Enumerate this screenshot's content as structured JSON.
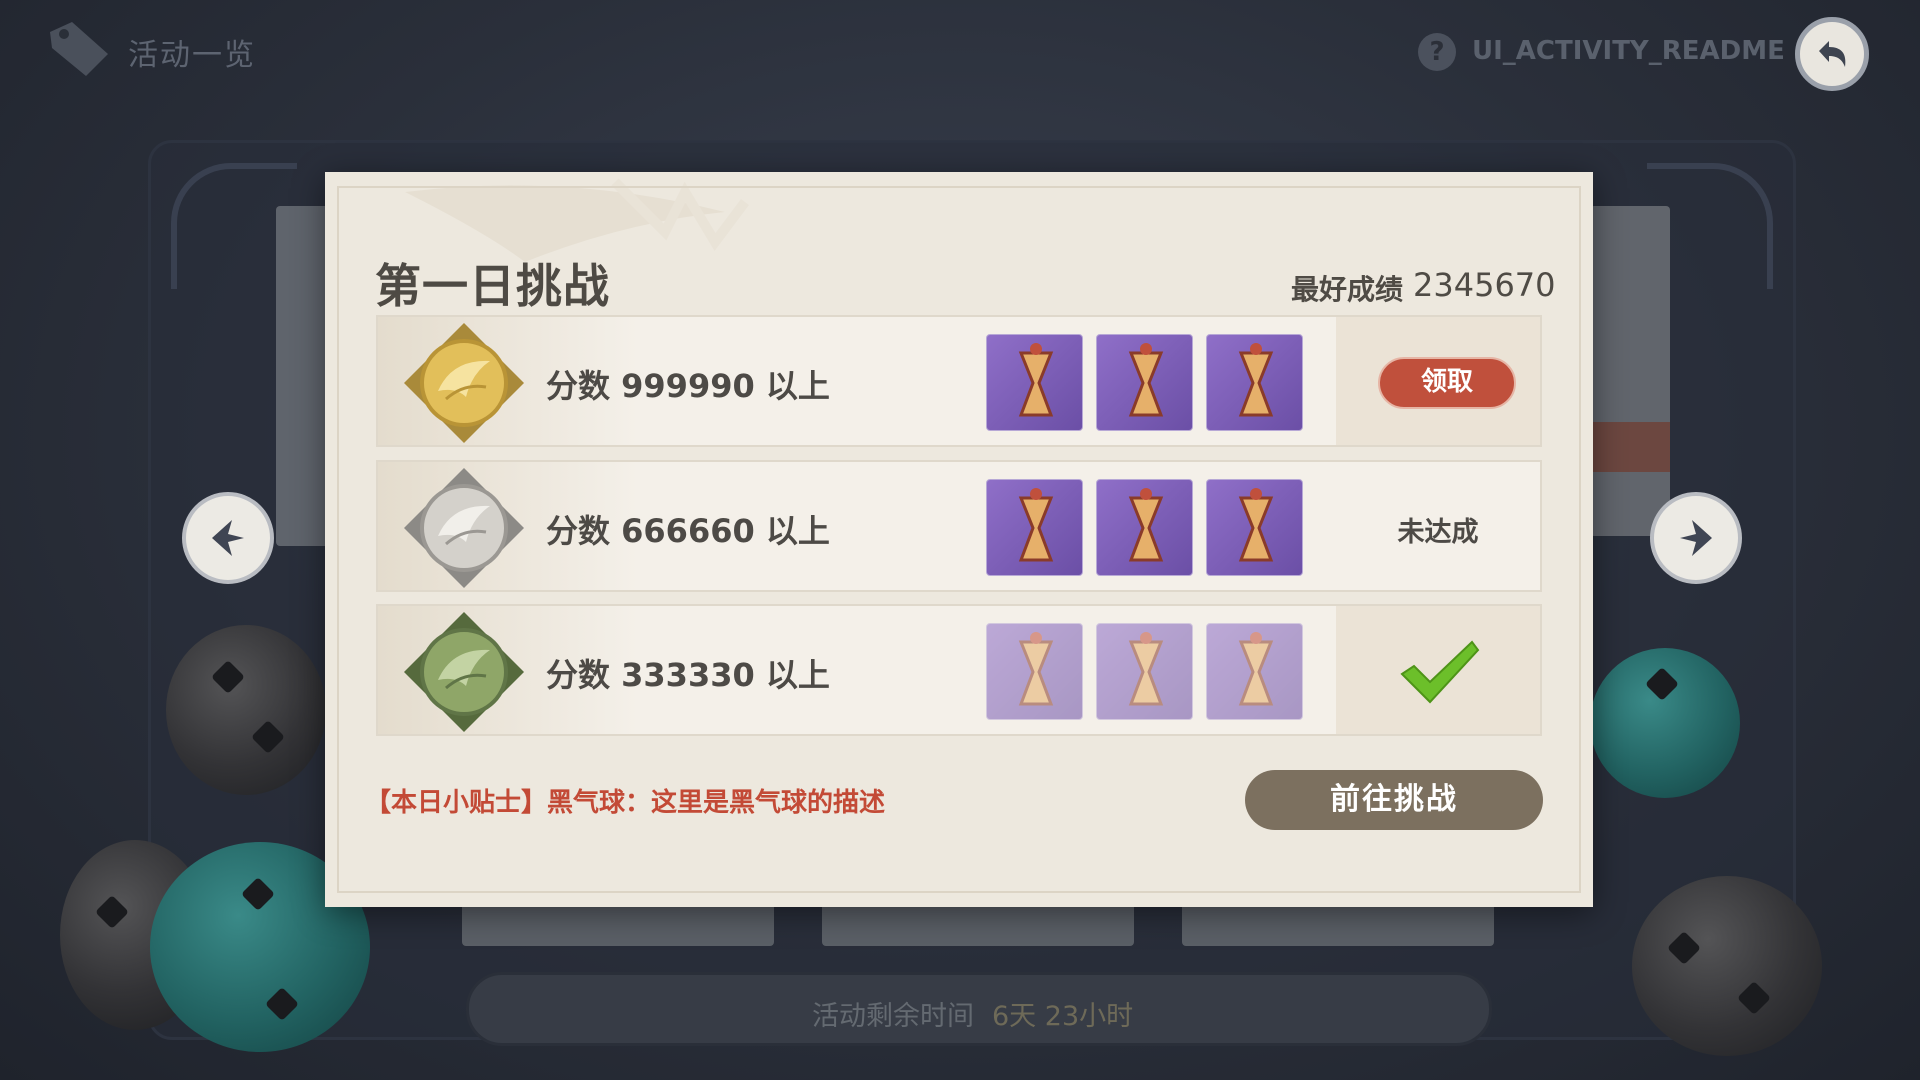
{
  "header": {
    "title": "活动一览",
    "readme_label": "UI_ACTIVITY_README",
    "help_symbol": "?"
  },
  "background": {
    "timer_label": "活动剩余时间",
    "timer_value": "6天 23小时"
  },
  "modal": {
    "title": "第一日挑战",
    "best_score_label": "最好成绩",
    "best_score_value": "2345670",
    "rewards": [
      {
        "label": "分数 999990 以上",
        "medal": "gold",
        "status": "claimable",
        "button_label": "领取",
        "item_icons": [
          "hourglass-reward-icon",
          "hourglass-reward-icon",
          "hourglass-reward-icon"
        ]
      },
      {
        "label": "分数 666660 以上",
        "medal": "silver",
        "status": "not_reached",
        "status_text": "未达成",
        "item_icons": [
          "hourglass-reward-icon",
          "hourglass-reward-icon",
          "hourglass-reward-icon"
        ]
      },
      {
        "label": "分数 333330 以上",
        "medal": "bronze",
        "status": "claimed",
        "item_icons": [
          "hourglass-reward-icon",
          "hourglass-reward-icon",
          "hourglass-reward-icon"
        ]
      }
    ],
    "tip": "【本日小贴士】黑气球：这里是黑气球的描述",
    "go_button_label": "前往挑战"
  },
  "colors": {
    "accent_red": "#c0503c",
    "tip_red": "#c34a36",
    "go_button": "#7c705f",
    "check_green": "#6cbf2a",
    "item_purple": "#7b5db8"
  }
}
